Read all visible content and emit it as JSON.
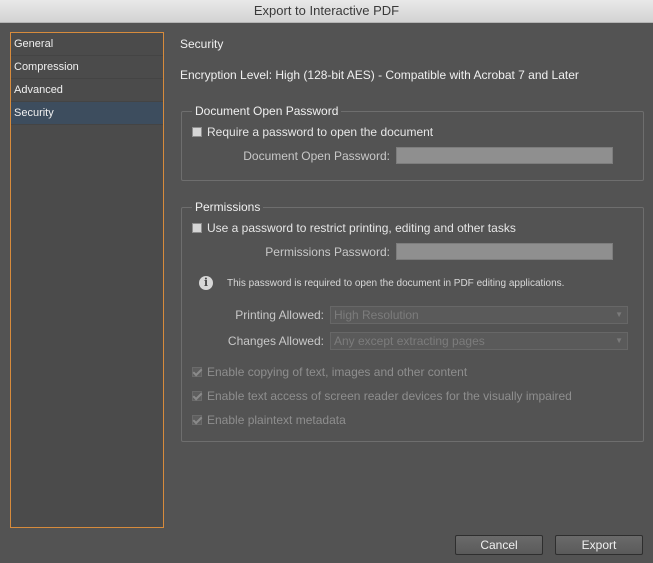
{
  "window": {
    "title": "Export to Interactive PDF"
  },
  "sidebar": {
    "items": [
      {
        "label": "General"
      },
      {
        "label": "Compression"
      },
      {
        "label": "Advanced"
      },
      {
        "label": "Security"
      }
    ],
    "selected": "Security"
  },
  "section_title": "Security",
  "encryption_level": "Encryption Level: High (128-bit AES) - Compatible with Acrobat 7 and Later",
  "open_password": {
    "group_label": "Document Open Password",
    "require_label": "Require a password to open the document",
    "require_checked": false,
    "field_label": "Document Open Password:",
    "field_value": ""
  },
  "permissions": {
    "group_label": "Permissions",
    "use_label": "Use a password to restrict printing, editing and other tasks",
    "use_checked": false,
    "field_label": "Permissions Password:",
    "field_value": "",
    "info_text": "This password is required to open the document in PDF editing applications.",
    "printing_label": "Printing Allowed:",
    "printing_value": "High Resolution",
    "changes_label": "Changes Allowed:",
    "changes_value": "Any except extracting pages",
    "options": [
      {
        "label": "Enable copying of text, images and other content",
        "checked": true
      },
      {
        "label": "Enable text access of screen reader devices for the visually impaired",
        "checked": true
      },
      {
        "label": "Enable plaintext metadata",
        "checked": true
      }
    ]
  },
  "buttons": {
    "cancel": "Cancel",
    "export": "Export"
  },
  "colors": {
    "background": "#535353",
    "selection": "#3d4d5e",
    "focus_border": "#d78b3c"
  }
}
